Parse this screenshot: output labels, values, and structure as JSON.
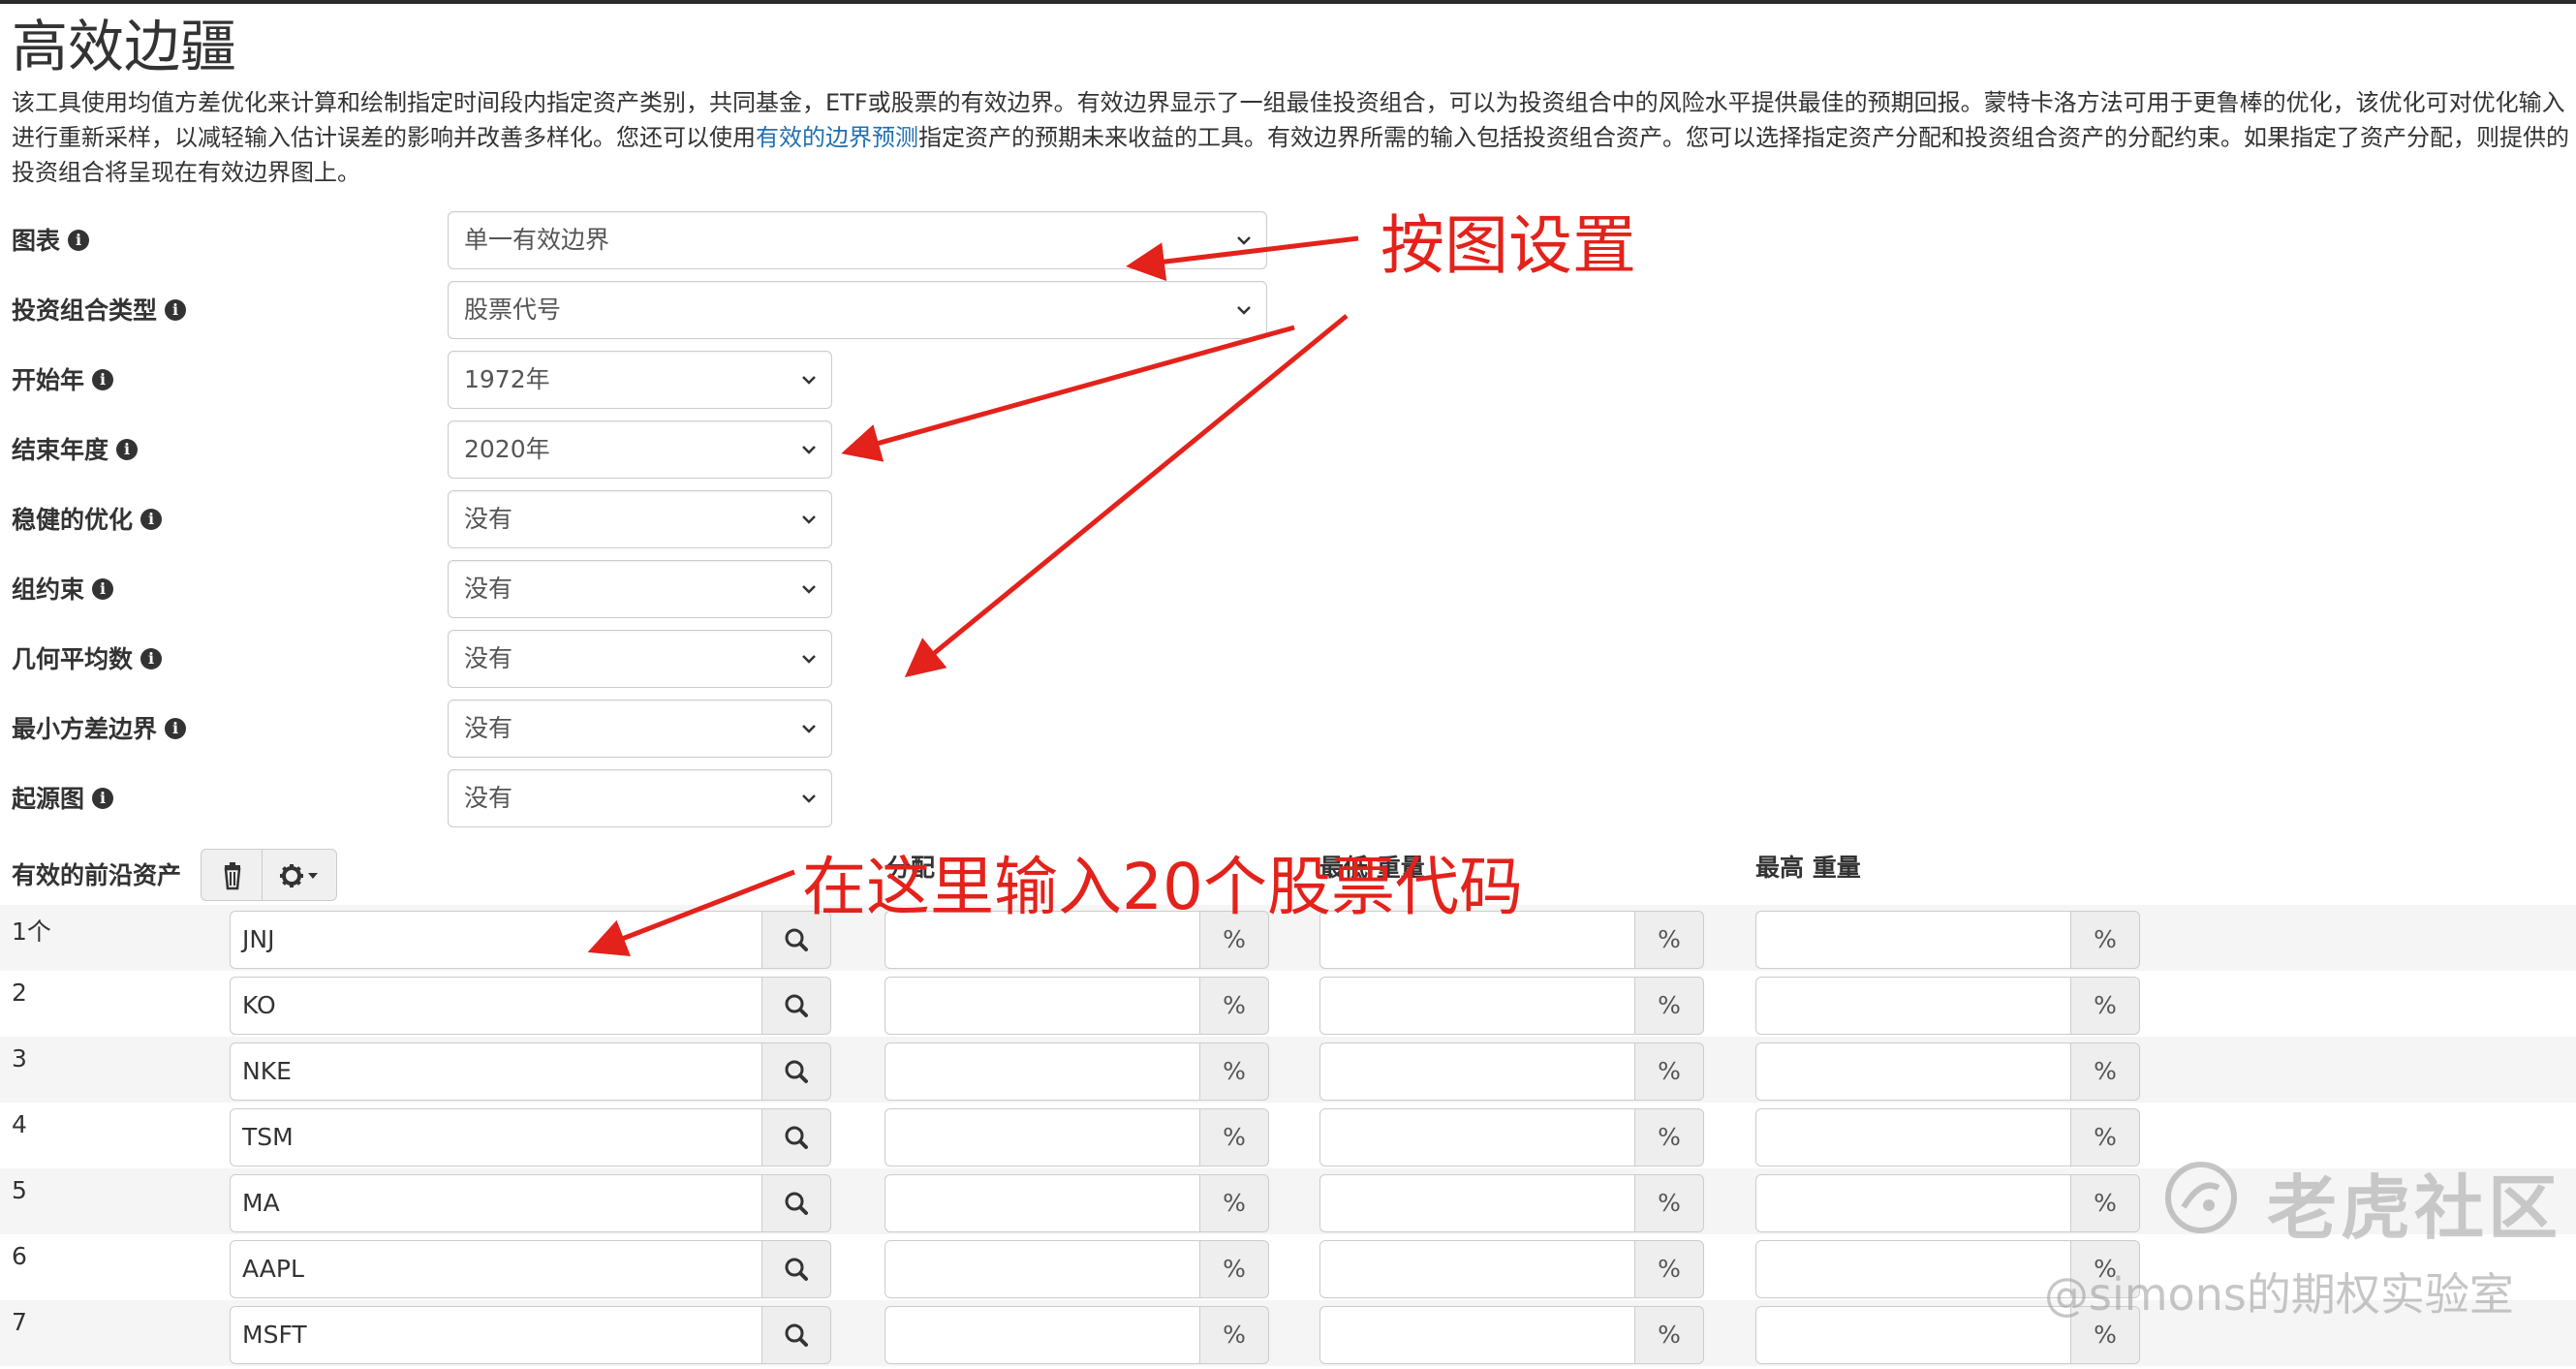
{
  "page": {
    "title": "高效边疆",
    "description_part1": "该工具使用均值方差优化来计算和绘制指定时间段内指定资产类别，共同基金，ETF或股票的有效边界。有效边界显示了一组最佳投资组合，可以为投资组合中的风险水平提供最佳的预期回报。蒙特卡洛方法可用于更鲁棒的优化，该优化可对优化输入进行重新采样，以减轻输入估计误差的影响并改善多样化。您还可以使用",
    "description_link": "有效的边界预测",
    "description_part2": "指定资产的预期未来收益的工具。有效边界所需的输入包括投资组合资产。您可以选择指定资产分配和投资组合资产的分配约束。如果指定了资产分配，则提供的投资组合将呈现在有效边界图上。"
  },
  "form": {
    "fields": [
      {
        "label": "图表",
        "value": "单一有效边界"
      },
      {
        "label": "投资组合类型",
        "value": "股票代号"
      },
      {
        "label": "开始年",
        "value": "1972年"
      },
      {
        "label": "结束年度",
        "value": "2020年"
      },
      {
        "label": "稳健的优化",
        "value": "没有"
      },
      {
        "label": "组约束",
        "value": "没有"
      },
      {
        "label": "几何平均数",
        "value": "没有"
      },
      {
        "label": "最小方差边界",
        "value": "没有"
      },
      {
        "label": "起源图",
        "value": "没有"
      }
    ],
    "info_glyph": "i"
  },
  "assets": {
    "label": "有效的前沿资产",
    "col_allocation": "分配",
    "col_min_weight": "最低 重量",
    "col_max_weight": "最高 重量",
    "percent_symbol": "%",
    "rows": [
      {
        "num": "1个",
        "ticker": "JNJ"
      },
      {
        "num": "2",
        "ticker": "KO"
      },
      {
        "num": "3",
        "ticker": "NKE"
      },
      {
        "num": "4",
        "ticker": "TSM"
      },
      {
        "num": "5",
        "ticker": "MA"
      },
      {
        "num": "6",
        "ticker": "AAPL"
      },
      {
        "num": "7",
        "ticker": "MSFT"
      }
    ]
  },
  "annotations": {
    "settings_note": "按图设置",
    "tickers_note": "在这里输入20个股票代码",
    "color": "#e3221b"
  },
  "watermark": {
    "brand": "老虎社区",
    "author": "@simons的期权实验室"
  }
}
